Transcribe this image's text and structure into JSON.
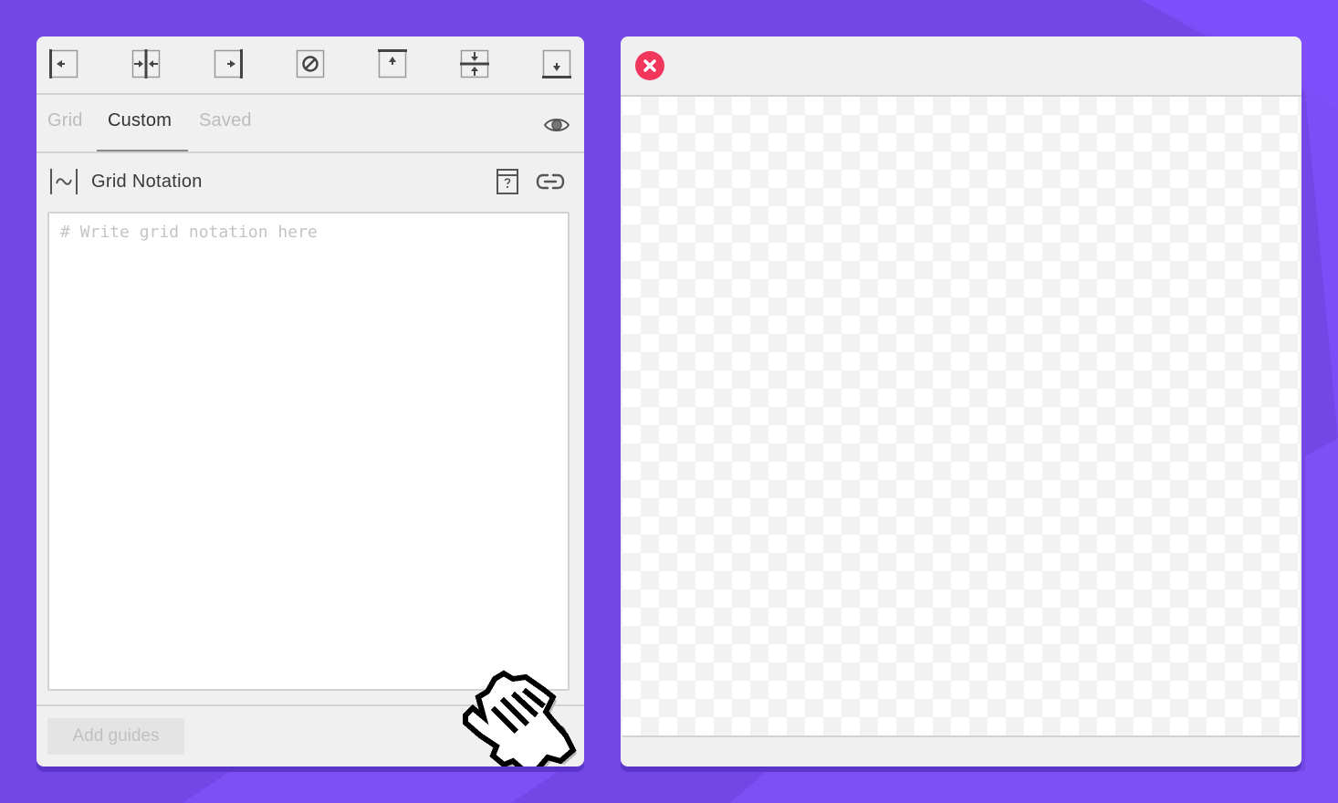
{
  "toolbar": {
    "buttons": [
      {
        "icon": "align-left-icon"
      },
      {
        "icon": "align-center-horizontal-icon"
      },
      {
        "icon": "align-right-icon"
      },
      {
        "icon": "clear-guides-icon"
      },
      {
        "icon": "align-top-icon"
      },
      {
        "icon": "align-middle-vertical-icon"
      },
      {
        "icon": "align-bottom-icon"
      }
    ]
  },
  "tabs": [
    {
      "label": "Grid",
      "active": false
    },
    {
      "label": "Custom",
      "active": true
    },
    {
      "label": "Saved",
      "active": false
    }
  ],
  "section": {
    "title": "Grid Notation",
    "help_icon": "help-book-icon",
    "link_icon": "link-icon"
  },
  "editor": {
    "placeholder": "# Write grid notation here",
    "value": ""
  },
  "footer": {
    "add_label": "Add guides"
  },
  "colors": {
    "background": "#7247e6",
    "close": "#f2365b",
    "panel": "#f0f0f0"
  }
}
